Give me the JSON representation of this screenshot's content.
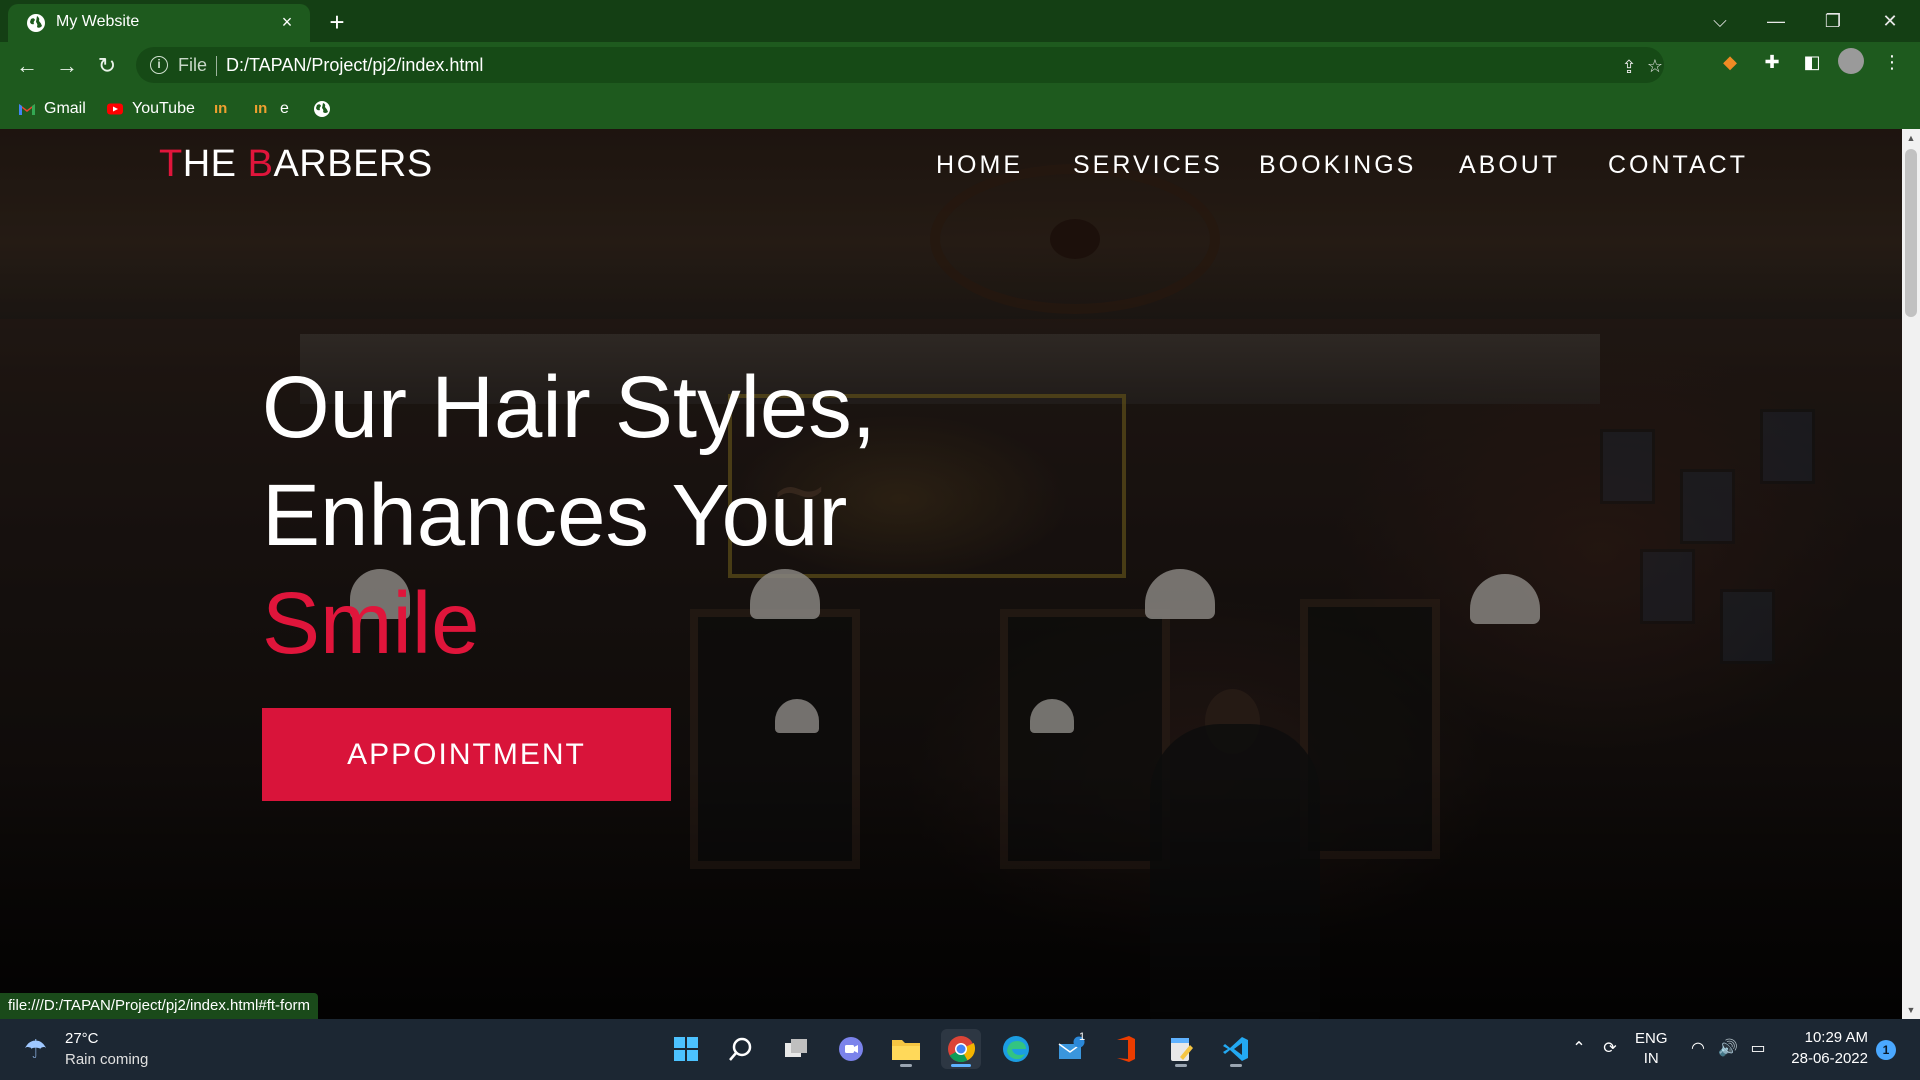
{
  "browser": {
    "tab": {
      "title": "My Website",
      "favicon": "globe-icon",
      "close": "×"
    },
    "new_tab": "+",
    "window_controls": {
      "tab_search": "⌵",
      "minimize": "—",
      "restore": "❐",
      "close": "✕"
    },
    "address": {
      "scheme": "File",
      "url": "D:/TAPAN/Project/pj2/index.html"
    },
    "bookmarks": [
      {
        "label": "Gmail",
        "icon": "gmail-icon"
      },
      {
        "label": "YouTube",
        "icon": "youtube-icon"
      },
      {
        "label": "",
        "icon": "in-icon"
      },
      {
        "label": "e",
        "icon": "in-icon"
      },
      {
        "label": "",
        "icon": "globe-icon"
      }
    ],
    "status_url": "file:///D:/TAPAN/Project/pj2/index.html#ft-form"
  },
  "site": {
    "logo": {
      "first_letter": "T",
      "first_rest": "HE ",
      "second_letter": "B",
      "second_rest": "ARBERS"
    },
    "menu": [
      "HOME",
      "SERVICES",
      "BOOKINGS",
      "ABOUT",
      "CONTACT"
    ],
    "hero": {
      "line1": "Our Hair Styles,",
      "line2": "Enhances Your",
      "line3": "Smile"
    },
    "cta": "APPOINTMENT",
    "colors": {
      "accent": "#e0153b",
      "browser_frame": "#1e5a1e"
    }
  },
  "taskbar": {
    "weather": {
      "temp": "27°C",
      "desc": "Rain coming"
    },
    "language": {
      "line1": "ENG",
      "line2": "IN"
    },
    "clock": {
      "time": "10:29 AM",
      "date": "28-06-2022"
    },
    "mail_badge": "1",
    "notification_count": "1"
  }
}
